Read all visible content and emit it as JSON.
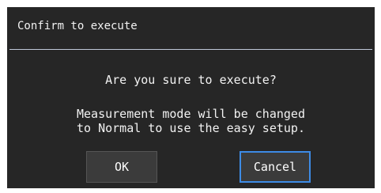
{
  "dialog": {
    "title": "Confirm to execute",
    "question": "Are you sure to execute?",
    "message_lines": [
      "Measurement mode will be changed",
      "to Normal to use the easy setup."
    ],
    "ok_label": "OK",
    "cancel_label": "Cancel",
    "focused_button": "cancel"
  },
  "colors": {
    "background": "#262626",
    "divider": "#bfc8d8",
    "focus_border": "#3d8be6",
    "button_fill": "#3b3b3b"
  }
}
